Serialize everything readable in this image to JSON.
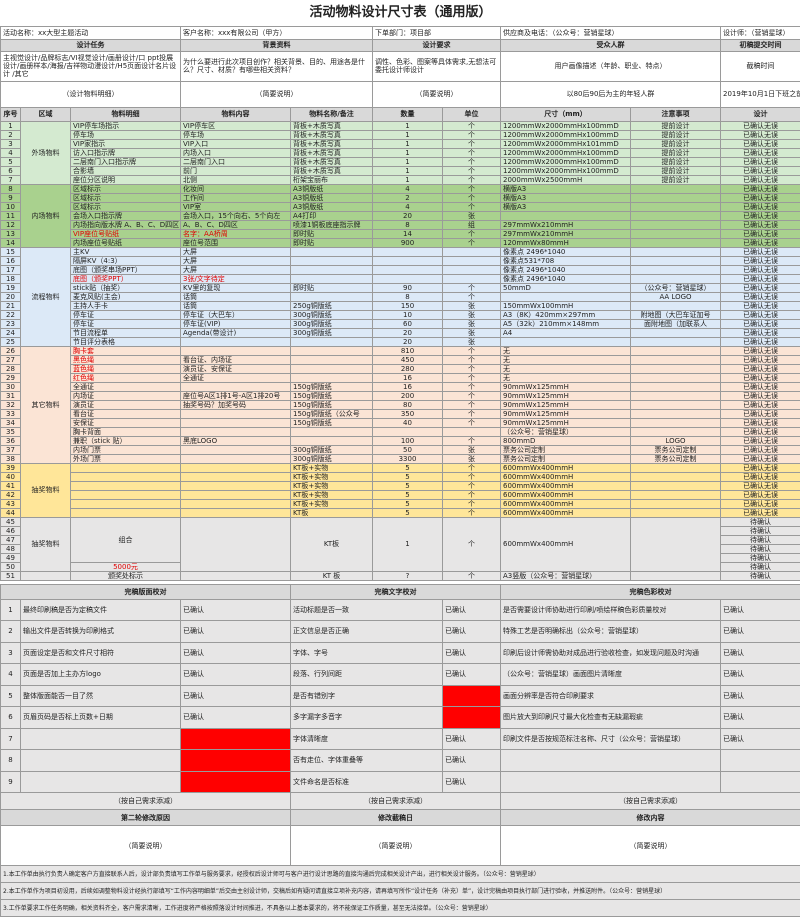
{
  "title": "活动物料设计尺寸表（通用版）",
  "info": {
    "activity": "活动名称：xx大型主题活动",
    "client": "客户名称：xxx有限公司（甲方）",
    "department": "下单部门：项目部",
    "supplier": "供应商及电话：（公众号：营销星球）",
    "designer": "设计师：（营销星球）"
  },
  "sections": {
    "task": "设计任务",
    "background": "背景资料",
    "requirements": "设计要求",
    "audience": "受众人群",
    "deadline": "初稿提交时间"
  },
  "details": {
    "task": "主视觉设计/品牌标志/VI视觉设计/画册设计/口 ppt投展设计/画册样本/海报/吉祥物动漫设计/H5页面设计名片设计 /其它",
    "background": "为什么要进行此次项目创作？相关背景、目的、用途各是什么？尺寸、材质？有哪些相关资料？",
    "requirements": "调性、色彩、图案等具体需求,无想法可委托设计师设计",
    "audience": "用户画像描述（年龄、职业、特点）",
    "deadline": "截稿时间"
  },
  "notes": {
    "task": "（设计物料明细）",
    "background": "（简要说明）",
    "requirements": "（简要说明）",
    "audience": "以80后90后为主的年轻人群",
    "deadline": "2019年10月1日下班之前"
  },
  "columns": [
    "序号",
    "区域",
    "物料明细",
    "物料内容",
    "物料名称/备注",
    "数量",
    "单位",
    "尺寸（mm）",
    "注意事项",
    "设计"
  ],
  "areas": [
    "外场物料",
    "内场物料",
    "流程物料",
    "其它物料",
    "抽奖物料",
    "抽奖物料"
  ],
  "rows": [
    [
      "1",
      "VIP停车场指示",
      "VIP停车区",
      "背板+木质写真",
      "1",
      "个",
      "1200mmWx2000mmHx100mmD",
      "提前设计",
      "已确认无误"
    ],
    [
      "2",
      "停车场",
      "停车场",
      "背板+木质写真",
      "1",
      "个",
      "1200mmWx2000mmHx100mmD",
      "提前设计",
      "已确认无误"
    ],
    [
      "3",
      "VIP家指示",
      "VIP入口",
      "背板+木质写真",
      "1",
      "个",
      "1200mmWx2000mmHx101mmD",
      "提前设计",
      "已确认无误"
    ],
    [
      "4",
      "访入口指示牌",
      "内场入口",
      "背板+木质写真",
      "1",
      "个",
      "1200mmWx2000mmHx100mmD",
      "提前设计",
      "已确认无误"
    ],
    [
      "5",
      "二层南门入口指示牌",
      "二层南门入口",
      "背板+木质写真",
      "1",
      "个",
      "1200mmWx2000mmHx100mmD",
      "提前设计",
      "已确认无误"
    ],
    [
      "6",
      "合影墙",
      "前门",
      "背板+木质写真",
      "1",
      "个",
      "1200mmWx2000mmHx100mmD",
      "提前设计",
      "已确认无误"
    ],
    [
      "7",
      "座位分区说明",
      "北侧",
      "桁架宝丽布",
      "1",
      "个",
      "2000mmWx2500mmH",
      "提前设计",
      "已确认无误"
    ],
    [
      "8",
      "区域标示",
      "化妆间",
      "A3铜版纸",
      "4",
      "个",
      "横版A3",
      "",
      "已确认无误"
    ],
    [
      "9",
      "区域标示",
      "工作间",
      "A3铜版纸",
      "2",
      "个",
      "横版A3",
      "",
      "已确认无误"
    ],
    [
      "10",
      "区域标示",
      "VIP室",
      "A3铜版纸",
      "4",
      "个",
      "横版A3",
      "",
      "已确认无误"
    ],
    [
      "11",
      "会场入口指示牌",
      "会场入口，15个向右、5个向左",
      "A4打印",
      "20",
      "张",
      "",
      "",
      "已确认无误"
    ],
    [
      "12",
      "内场指向版水牌 A、B、C、D四区",
      "A、B、C、D四区",
      "喷漆1铜板底座指示牌",
      "8",
      "组",
      "297mmWx210mmH",
      "",
      "已确认无误"
    ],
    [
      "13",
      "VIP座位号贴纸",
      "名字：AA桥周",
      "即时贴",
      "14",
      "个",
      "297mmWx210mmH",
      "",
      "已确认无误"
    ],
    [
      "14",
      "内场座位号贴纸",
      "座位号范围",
      "即时贴",
      "900",
      "个",
      "120mmWx80mmH",
      "",
      "已确认无误"
    ],
    [
      "15",
      "主KV",
      "大屏",
      "",
      "",
      "",
      "像素点 2496*1040",
      "",
      "已确认无误"
    ],
    [
      "16",
      "隔屏KV（4:3）",
      "大屏",
      "",
      "",
      "",
      "像素点531*708",
      "",
      "已确认无误"
    ],
    [
      "17",
      "底图（颁奖串场PPT）",
      "大屏",
      "",
      "",
      "",
      "像素点 2496*1040",
      "",
      "已确认无误"
    ],
    [
      "18",
      "底图（颁奖PPT）",
      "3张/文字待定",
      "",
      "",
      "",
      "像素点 2496*1040",
      "",
      "已确认无误"
    ],
    [
      "19",
      "stick贴（抽奖）",
      "KV里的复现",
      "即时贴",
      "90",
      "个",
      "50mmD",
      "（公众号：营销星球）",
      "已确认无误"
    ],
    [
      "20",
      "麦克风贴(主会)",
      "话筒",
      "",
      "8",
      "个",
      "",
      "AA LOGO",
      "已确认无误"
    ],
    [
      "21",
      "主持人手卡",
      "话筒",
      "250g铜版纸",
      "150",
      "张",
      "150mmWx100mmH",
      "",
      "已确认无误"
    ],
    [
      "22",
      "停车证",
      "停车证（大巴车）",
      "300g铜版纸",
      "10",
      "张",
      "A3（8K）420mm×297mm",
      "附地图（大巴车证加号",
      "已确认无误"
    ],
    [
      "23",
      "停车证",
      "停车证(VIP)",
      "300g铜版纸",
      "60",
      "张",
      "A5（32k）210mm×148mm",
      "面附地图（加联系人",
      "已确认无误"
    ],
    [
      "24",
      "节目流程单",
      "Agenda(带设计)",
      "300g铜版纸",
      "20",
      "张",
      "A4",
      "",
      "已确认无误"
    ],
    [
      "25",
      "节目评分表格",
      "",
      "",
      "20",
      "张",
      "",
      "",
      "已确认无误"
    ],
    [
      "26",
      "胸卡套",
      "",
      "",
      "810",
      "个",
      "无",
      "",
      "已确认无误"
    ],
    [
      "27",
      "黑色绳",
      "看台证、内场证",
      "",
      "450",
      "个",
      "无",
      "",
      "已确认无误"
    ],
    [
      "28",
      "蓝色绳",
      "演员证、安保证",
      "",
      "280",
      "个",
      "无",
      "",
      "已确认无误"
    ],
    [
      "29",
      "红色绳",
      "全通证",
      "",
      "16",
      "个",
      "无",
      "",
      "已确认无误"
    ],
    [
      "30",
      "全通证",
      "",
      "150g铜版纸",
      "16",
      "个",
      "90mmWx125mmH",
      "",
      "已确认无误"
    ],
    [
      "31",
      "内场证",
      "座位号A区1排1号-A区1排20号",
      "150g铜版纸",
      "200",
      "个",
      "90mmWx125mmH",
      "",
      "已确认无误"
    ],
    [
      "32",
      "演员证",
      "抽奖号码？加奖号码",
      "150g铜版纸",
      "80",
      "个",
      "90mmWx125mmH",
      "",
      "已确认无误"
    ],
    [
      "33",
      "看台证",
      "",
      "150g铜版纸（公众号",
      "350",
      "个",
      "90mmWx125mmH",
      "",
      "已确认无误"
    ],
    [
      "34",
      "安保证",
      "",
      "150g铜版纸",
      "40",
      "个",
      "90mmWx125mmH",
      "",
      "已确认无误"
    ],
    [
      "35",
      "胸卡背面",
      "",
      "",
      "",
      "",
      "（公众号：营销星球）",
      "",
      "已确认无误"
    ],
    [
      "36",
      "兼职（stick 贴）",
      "黑底LOGO",
      "",
      "100",
      "个",
      "800mmD",
      "LOGO",
      "已确认无误"
    ],
    [
      "37",
      "内场门票",
      "",
      "300g铜版纸",
      "50",
      "张",
      "票务公司定制",
      "票务公司定制",
      "已确认无误"
    ],
    [
      "38",
      "外场门票",
      "",
      "300g铜版纸",
      "3300",
      "张",
      "票务公司定制",
      "票务公司定制",
      "已确认无误"
    ],
    [
      "39",
      "",
      "",
      "KT板+实物",
      "5",
      "个",
      "600mmWx400mmH",
      "",
      "已确认无误"
    ],
    [
      "40",
      "",
      "",
      "KT板+实物",
      "5",
      "个",
      "600mmWx400mmH",
      "",
      "已确认无误"
    ],
    [
      "41",
      "",
      "",
      "KT板+实物",
      "5",
      "个",
      "600mmWx400mmH",
      "",
      "已确认无误"
    ],
    [
      "42",
      "",
      "",
      "KT板+实物",
      "5",
      "个",
      "600mmWx400mmH",
      "",
      "已确认无误"
    ],
    [
      "43",
      "",
      "",
      "KT板+实物",
      "5",
      "个",
      "600mmWx400mmH",
      "",
      "已确认无误"
    ],
    [
      "44",
      "",
      "",
      "KT板",
      "5",
      "个",
      "600mmWx400mmH",
      "",
      "已确认无误"
    ]
  ],
  "group": {
    "rows": [
      "45",
      "46",
      "47",
      "48",
      "49",
      "50"
    ],
    "name": "组合",
    "material": "KT板",
    "qty": "1",
    "unit": "个",
    "size": "600mmWx400mmH",
    "extra": "5000元",
    "status": [
      "待确认",
      "待确认",
      "待确认",
      "待确认",
      "待确认",
      "待确认"
    ]
  },
  "row51": {
    "no": "51",
    "name": "颁奖处标示",
    "material": "KT 板",
    "qty": "?",
    "unit": "个",
    "size": "A3竖版（公众号：营销星球）",
    "status": "待确认"
  },
  "checks": {
    "header": [
      "完稿版面校对",
      "完稿文字校对",
      "完稿色彩校对"
    ],
    "nums": [
      "1",
      "2",
      "3",
      "4",
      "5",
      "6",
      "7",
      "8",
      "9"
    ],
    "layout": [
      "最终印刷稿是否为定稿文件",
      "输出文件是否转换为印刷格式",
      "页面设定是否和文件尺寸相符",
      "页面是否加上主办方logo",
      "整体版面能否一目了然",
      "页眉页码是否标上页数+日期",
      "",
      "",
      ""
    ],
    "layout_status": [
      "已确认",
      "已确认",
      "已确认",
      "已确认",
      "已确认",
      "已确认",
      "",
      "",
      ""
    ],
    "text": [
      "活动标题是否一致",
      "正文信息是否正确",
      "字体、字号",
      "段落、行列间距",
      "是否有错别字",
      "多字漏字多音字",
      "字体清晰度",
      "否有走位、字体重叠等",
      "文件命名是否标准"
    ],
    "text_status": [
      "已确认",
      "已确认",
      "已确认",
      "已确认",
      "",
      "",
      "已确认",
      "已确认",
      "已确认"
    ],
    "color": [
      "是否需要设计师协助进行印刷/喷绘样稿色彩质量校对",
      "特殊工艺是否明确标出（公众号：营销星球）",
      "印刷后设计师需协助对成品进行验收检查，如发现问题及时沟通",
      "（公众号：营销星球）画面图片清晰度",
      "画面分辨率是否符合印刷要求",
      "图片放大到印刷尺寸最大化检查有无缺漏瑕疵",
      "印刷文件是否按规范标注名称、尺寸（公众号：营销星球）",
      "",
      ""
    ],
    "color_status": [
      "已确认",
      "已确认",
      "已确认",
      "已确认",
      "已确认",
      "已确认",
      "已确认",
      "",
      ""
    ],
    "red_layout": [
      6,
      7,
      8
    ],
    "red_text": [
      4,
      5
    ],
    "sup": "（按自己需求添减）"
  },
  "revision": {
    "headers": [
      "第二轮修改原因",
      "修改截稿日",
      "修改内容"
    ],
    "notes": [
      "（简要说明）",
      "（简要说明）",
      "（简要说明）"
    ]
  },
  "footer": [
    "1.本工作单由执行负责人确定客户方直接联系人后，设计部负责填写工作单与服务要求，经授权后设计师可与客户进行设计思路的直接沟通后完成相关设计产出，进行相关设计服务。（公众号：营销星球）",
    "2.本工作单作为项目初设用，后续如调整物料设计经执行部填写“工作内容明细单”后交由主创设计师，交稿后如有疑问请直接立项补充内容，请再填写所作“设计任务（补充）单”，设计完稿由项目执行部门进行验收，并推送附件。（公众号：营销星球）",
    "3.工作单要求工作任务明确，相关资料齐全，客户需求清晰，工作进度将严格按照落设计时间推进，不具备以上基本要求的，将不能保证工作质量，甚至无法接单。（公众号：营销星球）"
  ]
}
